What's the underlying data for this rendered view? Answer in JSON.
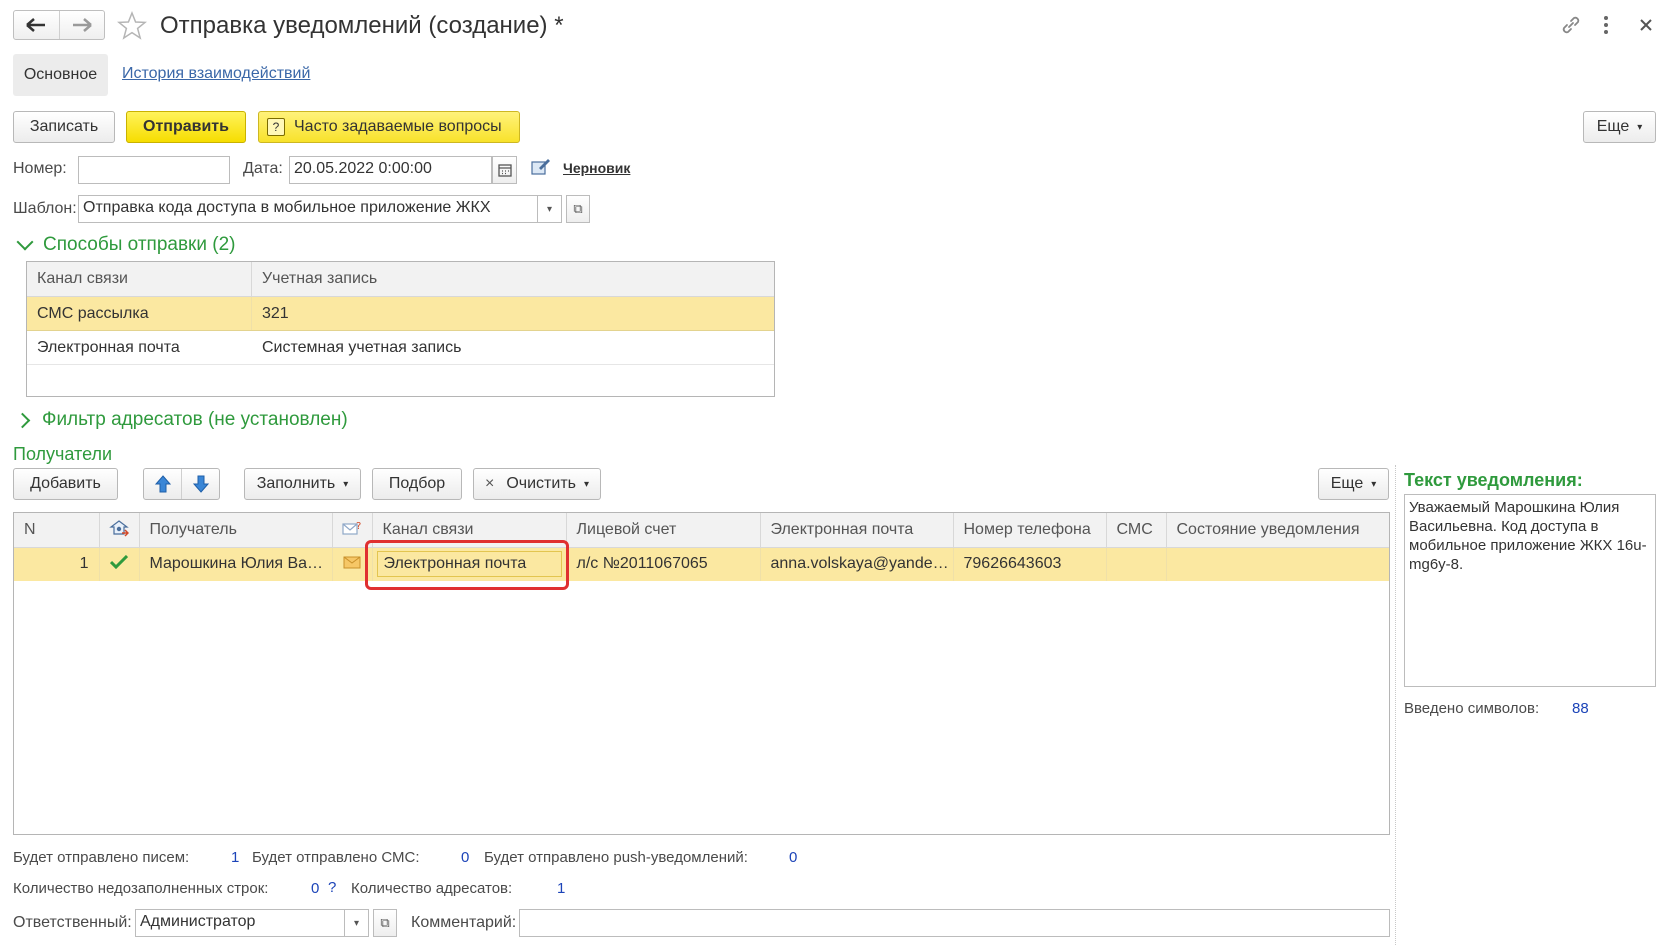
{
  "window": {
    "title": "Отправка уведомлений (создание) *",
    "nav_back_icon": "arrow-left-icon",
    "nav_forward_icon": "arrow-right-icon",
    "favorite_icon": "star-icon",
    "link_icon": "link-icon",
    "more_icon": "more-vertical-icon",
    "close_icon": "close-icon"
  },
  "tabs": [
    {
      "label": "Основное",
      "active": true
    },
    {
      "label": "История взаимодействий",
      "active": false
    }
  ],
  "toolbar": {
    "save_label": "Записать",
    "send_label": "Отправить",
    "faq_icon": "?",
    "faq_label": "Часто задаваемые вопросы",
    "more_label": "Еще"
  },
  "header_fields": {
    "number_label": "Номер:",
    "number_value": "",
    "date_label": "Дата:",
    "date_value": "20.05.2022  0:00:00",
    "status_link": "Черновик",
    "template_label": "Шаблон:",
    "template_value": "Отправка кода доступа в мобильное приложение ЖКХ"
  },
  "send_methods": {
    "title": "Способы отправки (2)",
    "columns": [
      "Канал связи",
      "Учетная запись"
    ],
    "rows": [
      {
        "channel": "СМС рассылка",
        "account": "321",
        "selected": true
      },
      {
        "channel": "Электронная почта",
        "account": "Системная учетная запись",
        "selected": false
      }
    ]
  },
  "filter": {
    "title": "Фильтр адресатов (не установлен)"
  },
  "recipients": {
    "title": "Получатели",
    "add_label": "Добавить",
    "fill_label": "Заполнить",
    "pick_label": "Подбор",
    "clear_icon": "×",
    "clear_label": "Очистить",
    "more_label": "Еще",
    "columns": {
      "n": "N",
      "recipient": "Получатель",
      "channel": "Канал связи",
      "account": "Лицевой счет",
      "email": "Электронная почта",
      "phone": "Номер телефона",
      "sms": "СМС",
      "state": "Состояние уведомления"
    },
    "rows": [
      {
        "n": "1",
        "checked": true,
        "recipient": "Марошкина Юлия Ва…",
        "channel": "Электронная почта",
        "account": "л/с №2011067065",
        "email": "anna.volskaya@yande…",
        "phone": "79626643603",
        "sms": "",
        "state": ""
      }
    ]
  },
  "notification": {
    "title": "Текст уведомления:",
    "text": "Уважаемый Марошкина Юлия Васильевна. Код доступа в мобильное приложение ЖКХ 16u-mg6y-8.",
    "chars_label": "Введено символов:",
    "chars_value": "88"
  },
  "summary": {
    "letters_label": "Будет отправлено писем:",
    "letters_value": "1",
    "sms_label": "Будет отправлено СМС:",
    "sms_value": "0",
    "push_label": "Будет отправлено push-уведомлений:",
    "push_value": "0",
    "incomplete_label": "Количество недозаполненных строк:",
    "incomplete_value": "0",
    "incomplete_help": "?",
    "recipients_label": "Количество адресатов:",
    "recipients_value": "1"
  },
  "footer": {
    "responsible_label": "Ответственный:",
    "responsible_value": "Администратор",
    "comment_label": "Комментарий:",
    "comment_value": ""
  },
  "colors": {
    "accent_green": "#2f9a3d",
    "selection_yellow": "#fbe8a1",
    "button_yellow": "#f6dd00",
    "highlight_red": "#e03030",
    "value_blue": "#1c44b8"
  }
}
